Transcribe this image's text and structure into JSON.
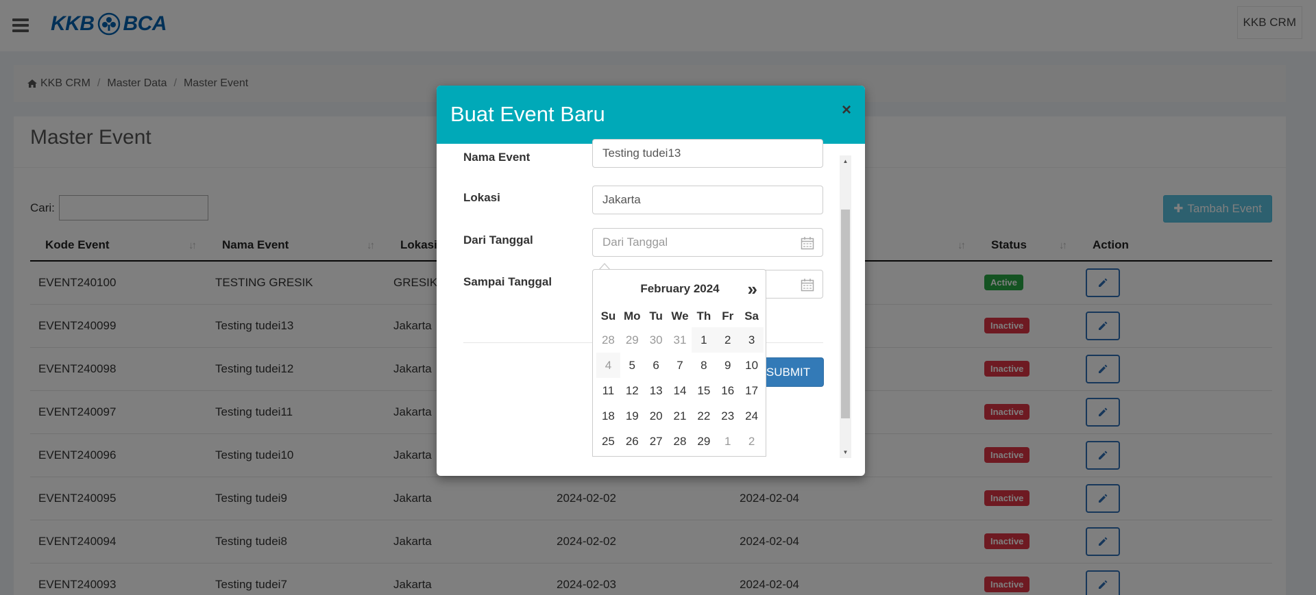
{
  "navbar": {
    "logo_text_left": "KKB",
    "logo_text_right": "BCA",
    "app_name": "KKB CRM",
    "menu_icon": "hamburger-menu-icon"
  },
  "breadcrumb": {
    "items": [
      "KKB CRM",
      "Master Data",
      "Master Event"
    ]
  },
  "page": {
    "title": "Master Event",
    "search_label": "Cari:",
    "add_button_label": "Tambah Event"
  },
  "table": {
    "columns": [
      "Kode Event",
      "Nama Event",
      "Lokasi",
      "",
      "",
      "Status",
      "Action"
    ],
    "rows": [
      {
        "kode": "EVENT240100",
        "nama": "TESTING GRESIK",
        "lokasi": "GRESIK",
        "dari": "",
        "sampai": "",
        "status": "Active"
      },
      {
        "kode": "EVENT240099",
        "nama": "Testing tudei13",
        "lokasi": "Jakarta",
        "dari": "",
        "sampai": "",
        "status": "Inactive"
      },
      {
        "kode": "EVENT240098",
        "nama": "Testing tudei12",
        "lokasi": "Jakarta",
        "dari": "",
        "sampai": "",
        "status": "Inactive"
      },
      {
        "kode": "EVENT240097",
        "nama": "Testing tudei11",
        "lokasi": "Jakarta",
        "dari": "",
        "sampai": "",
        "status": "Inactive"
      },
      {
        "kode": "EVENT240096",
        "nama": "Testing tudei10",
        "lokasi": "Jakarta",
        "dari": "",
        "sampai": "",
        "status": "Inactive"
      },
      {
        "kode": "EVENT240095",
        "nama": "Testing tudei9",
        "lokasi": "Jakarta",
        "dari": "2024-02-02",
        "sampai": "2024-02-04",
        "status": "Inactive"
      },
      {
        "kode": "EVENT240094",
        "nama": "Testing tudei8",
        "lokasi": "Jakarta",
        "dari": "2024-02-02",
        "sampai": "2024-02-04",
        "status": "Inactive"
      },
      {
        "kode": "EVENT240093",
        "nama": "Testing tudei7",
        "lokasi": "Jakarta",
        "dari": "2024-02-03",
        "sampai": "2024-02-04",
        "status": "Inactive"
      }
    ]
  },
  "modal": {
    "title": "Buat Event Baru",
    "close_label": "×",
    "fields": {
      "nama_event": {
        "label": "Nama Event",
        "value": "Testing tudei13"
      },
      "lokasi": {
        "label": "Lokasi",
        "value": "Jakarta"
      },
      "dari_tanggal": {
        "label": "Dari Tanggal",
        "placeholder": "Dari Tanggal"
      },
      "sampai_tanggal": {
        "label": "Sampai Tanggal"
      }
    },
    "submit_label": "SUBMIT"
  },
  "datepicker": {
    "month_label": "February 2024",
    "next_label": "»",
    "weekdays": [
      "Su",
      "Mo",
      "Tu",
      "We",
      "Th",
      "Fr",
      "Sa"
    ],
    "weeks": [
      [
        {
          "d": "28",
          "m": true
        },
        {
          "d": "29",
          "m": true
        },
        {
          "d": "30",
          "m": true
        },
        {
          "d": "31",
          "m": true
        },
        {
          "d": "1",
          "m": false
        },
        {
          "d": "2",
          "m": false
        },
        {
          "d": "3",
          "m": false
        }
      ],
      [
        {
          "d": "4",
          "m": false
        },
        {
          "d": "5",
          "m": false
        },
        {
          "d": "6",
          "m": false
        },
        {
          "d": "7",
          "m": false
        },
        {
          "d": "8",
          "m": false
        },
        {
          "d": "9",
          "m": false
        },
        {
          "d": "10",
          "m": false
        }
      ],
      [
        {
          "d": "11",
          "m": false
        },
        {
          "d": "12",
          "m": false
        },
        {
          "d": "13",
          "m": false
        },
        {
          "d": "14",
          "m": false
        },
        {
          "d": "15",
          "m": false
        },
        {
          "d": "16",
          "m": false
        },
        {
          "d": "17",
          "m": false
        }
      ],
      [
        {
          "d": "18",
          "m": false
        },
        {
          "d": "19",
          "m": false
        },
        {
          "d": "20",
          "m": false
        },
        {
          "d": "21",
          "m": false
        },
        {
          "d": "22",
          "m": false
        },
        {
          "d": "23",
          "m": false
        },
        {
          "d": "24",
          "m": false
        }
      ],
      [
        {
          "d": "25",
          "m": false
        },
        {
          "d": "26",
          "m": false
        },
        {
          "d": "27",
          "m": false
        },
        {
          "d": "28",
          "m": false
        },
        {
          "d": "29",
          "m": false
        },
        {
          "d": "1",
          "m": true
        },
        {
          "d": "2",
          "m": true
        }
      ]
    ]
  },
  "colors": {
    "modal_header": "#00a9b8",
    "active_badge": "#28a745",
    "inactive_badge": "#dc3545",
    "submit_button": "#337ab7",
    "add_button": "#5bc0de"
  }
}
